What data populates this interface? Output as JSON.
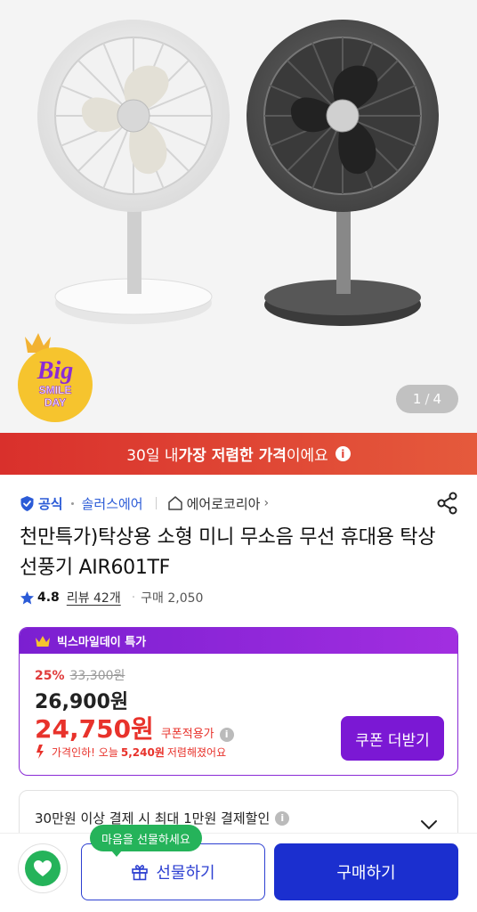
{
  "gallery": {
    "current": "1",
    "separator": "/",
    "total": "4",
    "badge_line1": "Big",
    "badge_line2": "SMILE",
    "badge_line3": "DAY"
  },
  "banner": {
    "prefix": "30일 내 ",
    "highlight": "가장 저렴한 가격",
    "suffix": "이에요"
  },
  "brand": {
    "official": "공식",
    "brand_name": "솔러스에어",
    "store_name": "에어로코리아"
  },
  "product": {
    "title": "천만특가)탁상용 소형 미니 무소음 무선 휴대용 탁상 선풍기 AIR601TF",
    "rating": "4.8",
    "review_label": "리뷰 42개",
    "purchase_label": "구매 2,050"
  },
  "deal": {
    "header": "빅스마일데이 특가",
    "discount_pct": "25%",
    "original_price": "33,300원",
    "sale_price": "26,900원",
    "coupon_price": "24,750원",
    "coupon_tag": "쿠폰적용가",
    "drop_prefix": "가격인하! 오늘",
    "drop_amount": "5,240원",
    "drop_suffix": "저렴해졌어요",
    "coupon_button": "쿠폰 더받기"
  },
  "promo": {
    "text": "30만원 이상 결제 시 최대 1만원 결제할인"
  },
  "bottom": {
    "tooltip": "마음을 선물하세요",
    "gift_label": "선물하기",
    "buy_label": "구매하기"
  },
  "colors": {
    "brand_blue": "#2b5bd7",
    "price_red": "#e8322b",
    "deal_purple": "#7b18d4",
    "buy_blue": "#1b2fcf",
    "wish_green": "#25b35a"
  }
}
